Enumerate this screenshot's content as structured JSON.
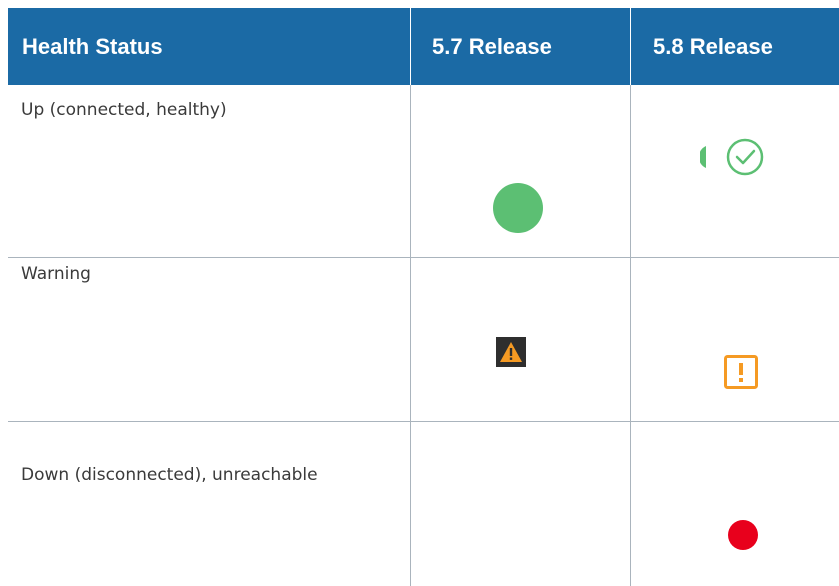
{
  "table": {
    "headers": [
      "Health Status",
      "5.7 Release",
      "5.8 Release"
    ],
    "rows": [
      {
        "status": "Up (connected, healthy)",
        "icon_57": "green-circle-icon",
        "icon_58": "green-check-circle-icon"
      },
      {
        "status": "Warning",
        "icon_57": "warning-triangle-icon",
        "icon_58": "exclamation-square-icon"
      },
      {
        "status": "Down (disconnected), unreachable",
        "icon_57": "",
        "icon_58": "red-circle-icon"
      }
    ]
  },
  "colors": {
    "header_bg": "#1b6aa5",
    "header_text": "#ffffff",
    "grid": "#aab4bd",
    "healthy_green": "#5cbf73",
    "warning_orange": "#f59a23",
    "warning_dark_bg": "#2e2e2e",
    "down_red": "#e8001c"
  }
}
